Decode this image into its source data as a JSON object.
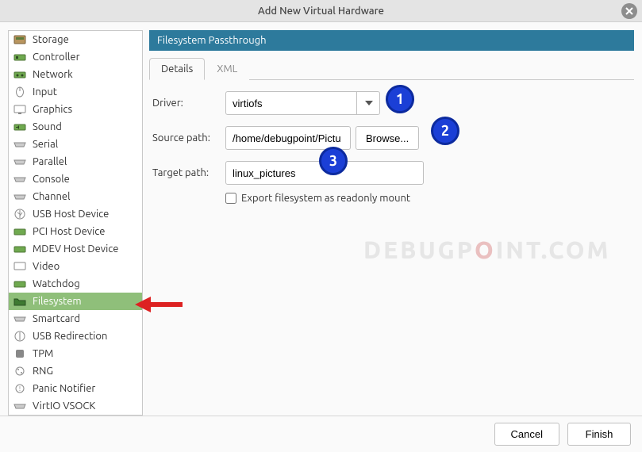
{
  "window": {
    "title": "Add New Virtual Hardware"
  },
  "sidebar": {
    "items": [
      {
        "label": "Storage",
        "icon": "storage"
      },
      {
        "label": "Controller",
        "icon": "controller"
      },
      {
        "label": "Network",
        "icon": "network"
      },
      {
        "label": "Input",
        "icon": "input"
      },
      {
        "label": "Graphics",
        "icon": "graphics"
      },
      {
        "label": "Sound",
        "icon": "sound"
      },
      {
        "label": "Serial",
        "icon": "serial"
      },
      {
        "label": "Parallel",
        "icon": "parallel"
      },
      {
        "label": "Console",
        "icon": "console"
      },
      {
        "label": "Channel",
        "icon": "channel"
      },
      {
        "label": "USB Host Device",
        "icon": "usb"
      },
      {
        "label": "PCI Host Device",
        "icon": "pci"
      },
      {
        "label": "MDEV Host Device",
        "icon": "mdev"
      },
      {
        "label": "Video",
        "icon": "video"
      },
      {
        "label": "Watchdog",
        "icon": "watchdog"
      },
      {
        "label": "Filesystem",
        "icon": "filesystem",
        "selected": true
      },
      {
        "label": "Smartcard",
        "icon": "smartcard"
      },
      {
        "label": "USB Redirection",
        "icon": "usbredir"
      },
      {
        "label": "TPM",
        "icon": "tpm"
      },
      {
        "label": "RNG",
        "icon": "rng"
      },
      {
        "label": "Panic Notifier",
        "icon": "panic"
      },
      {
        "label": "VirtIO VSOCK",
        "icon": "vsock"
      }
    ]
  },
  "panel": {
    "title": "Filesystem Passthrough",
    "tabs": {
      "details": "Details",
      "xml": "XML"
    },
    "labels": {
      "driver": "Driver:",
      "source": "Source path:",
      "target": "Target path:"
    },
    "driver_value": "virtiofs",
    "source_value": "/home/debugpoint/Pictu",
    "browse_label": "Browse...",
    "target_value": "linux_pictures",
    "readonly_label": "Export filesystem as readonly mount",
    "readonly_checked": false
  },
  "footer": {
    "cancel": "Cancel",
    "finish": "Finish"
  },
  "annotations": {
    "balloons": [
      "1",
      "2",
      "3"
    ],
    "watermark_a": "DEBUGP",
    "watermark_b": "O",
    "watermark_c": "INT.COM"
  }
}
